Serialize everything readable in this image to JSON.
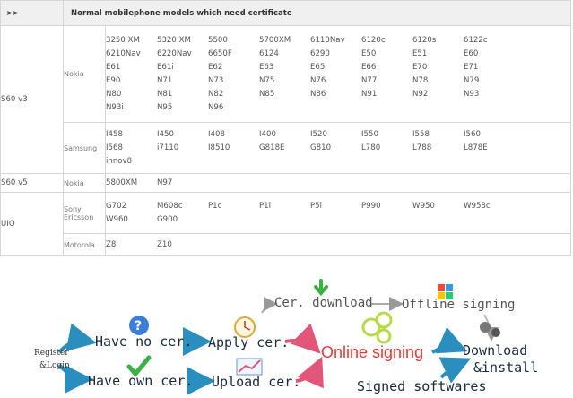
{
  "table": {
    "header": {
      "arrows": ">>",
      "title": "Normal mobilephone models which need certificate"
    },
    "sections": [
      {
        "platform": "S60 v3",
        "brand": "Nokia",
        "models": [
          "3250 XM",
          "5320 XM",
          "5500",
          "5700XM",
          "6110Nav",
          "6120c",
          "6120s",
          "6122c",
          "6210Nav",
          "6220Nav",
          "6650F",
          "6124",
          "6290",
          "E50",
          "E51",
          "E60",
          "E61",
          "E61i",
          "E62",
          "E63",
          "E65",
          "E66",
          "E70",
          "E71",
          "E90",
          "N71",
          "N73",
          "N75",
          "N76",
          "N77",
          "N78",
          "N79",
          "N80",
          "N81",
          "N82",
          "N85",
          "N86",
          "N91",
          "N92",
          "N93",
          "N93i",
          "N95",
          "N96"
        ]
      },
      {
        "platform": "",
        "brand": "Samsung",
        "models": [
          "I458",
          "I450",
          "I408",
          "I400",
          "I520",
          "I550",
          "I558",
          "I560",
          "I568",
          "i7110",
          "I8510",
          "G818E",
          "G810",
          "L780",
          "L788",
          "L878E",
          "innov8"
        ]
      },
      {
        "platform": "S60 v5",
        "brand": "Nokia",
        "models": [
          "5800XM",
          "N97"
        ]
      },
      {
        "platform": "UIQ",
        "brand": "Sony Ericsson",
        "models": [
          "G702",
          "M608c",
          "P1c",
          "P1i",
          "P5i",
          "P990",
          "W950",
          "W958c",
          "W960",
          "G900"
        ]
      },
      {
        "platform": "",
        "brand": "Motorola",
        "models": [
          "Z8",
          "Z10"
        ]
      }
    ]
  },
  "diagram": {
    "register_login_1": "Register",
    "register_login_2": "&Login",
    "have_no_cer": "Have no cer.",
    "have_own_cer": "Have own cer.",
    "apply_cer": "Apply cer.",
    "upload_cer": "Upload cer.",
    "online_signing": "Online signing",
    "cer_download": "Cer. download",
    "offline_signing": "Offline signing",
    "download_install_1": "Download",
    "download_install_2": "&install",
    "signed_softwares": "Signed softwares",
    "icons": [
      "question-icon",
      "checkmark-icon",
      "clock-icon",
      "chart-icon",
      "download-arrow-icon",
      "cubes-icon",
      "circles-icon",
      "gears-icon"
    ],
    "colors": {
      "arrow": "#2a8fbf",
      "online_arrow": "#e0577a",
      "online_text": "#e53935"
    }
  }
}
